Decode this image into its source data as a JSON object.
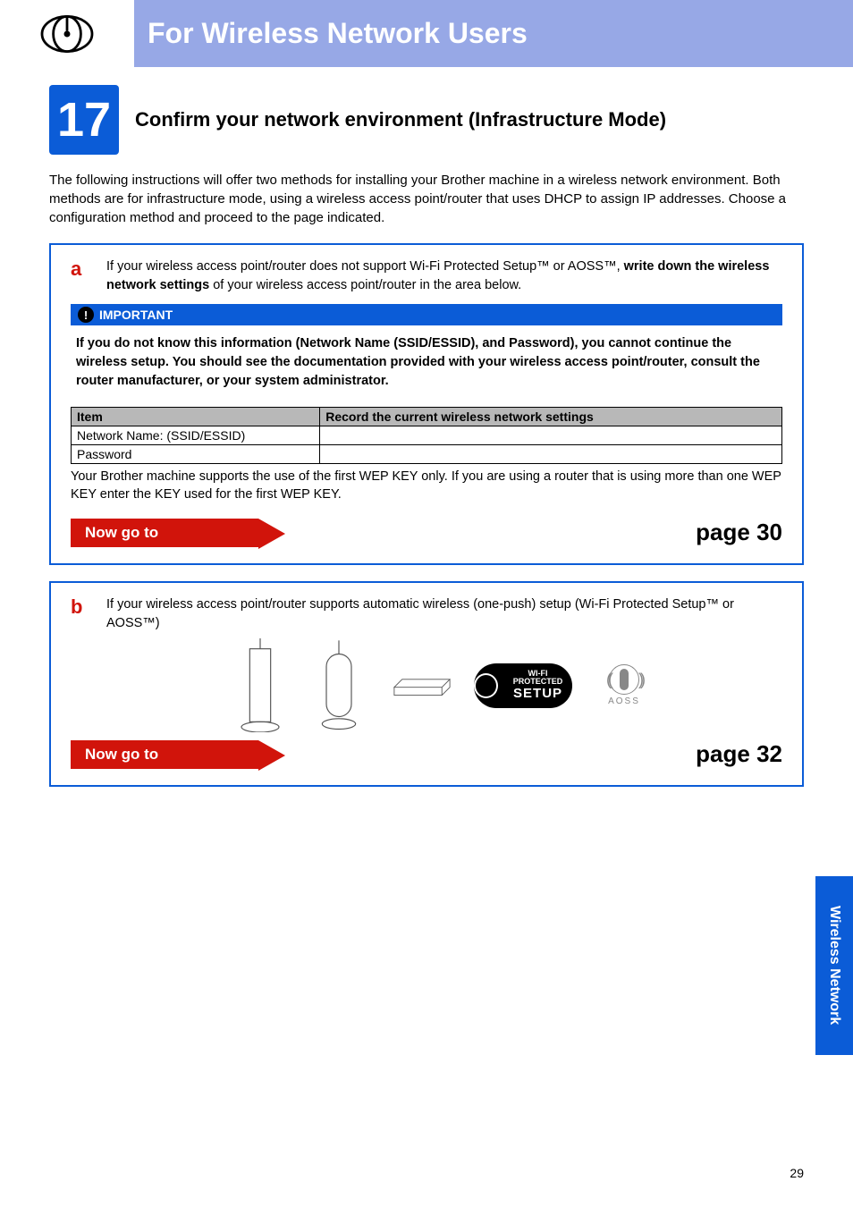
{
  "header": {
    "title": "For Wireless Network Users"
  },
  "step": {
    "number": "17",
    "title": "Confirm your network environment (Infrastructure Mode)"
  },
  "intro": "The following instructions will offer two methods for installing your Brother machine in a wireless network environment. Both methods are for infrastructure mode, using a wireless access point/router that uses DHCP to assign IP addresses. Choose a configuration method and proceed to the page indicated.",
  "methodA": {
    "letter": "a",
    "text_pre": "If your wireless access point/router does not support Wi-Fi Protected Setup™ or AOSS™, ",
    "text_bold": "write down the wireless network settings",
    "text_post": " of your wireless access point/router in the area below.",
    "important_label": "IMPORTANT",
    "important_body": "If you do not know this information (Network Name (SSID/ESSID), and Password), you cannot continue the wireless setup. You should see the documentation provided with your wireless access point/router, consult the router manufacturer, or your system administrator.",
    "table": {
      "col1": "Item",
      "col2": "Record the current wireless network settings",
      "rows": [
        "Network Name: (SSID/ESSID)",
        "Password"
      ]
    },
    "wep_note": "Your Brother machine supports the use of the first WEP KEY only. If you are using a router that is using more than one WEP KEY enter the KEY used for the first WEP KEY.",
    "goto_label": "Now go to",
    "goto_page": "page 30"
  },
  "methodB": {
    "letter": "b",
    "text": "If your wireless access point/router supports automatic wireless (one-push) setup (Wi-Fi Protected Setup™ or AOSS™)",
    "wps_label_top": "WI-FI PROTECTED",
    "wps_label_bottom": "SETUP",
    "aoss_label": "AOSS",
    "goto_label": "Now go to",
    "goto_page": "page 32"
  },
  "side_tab": "Wireless Network",
  "page_number": "29"
}
